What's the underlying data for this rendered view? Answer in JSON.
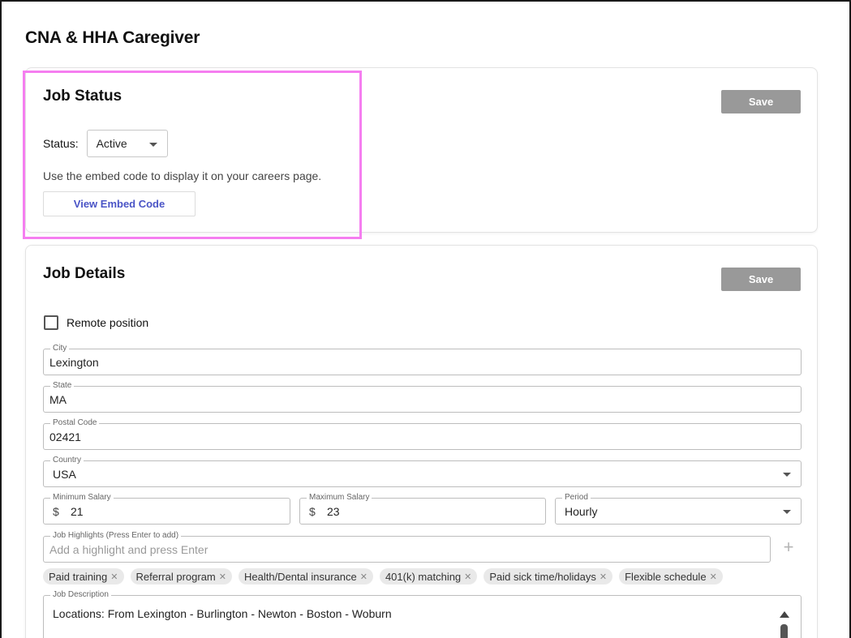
{
  "page": {
    "title": "CNA & HHA Caregiver"
  },
  "job_status": {
    "title": "Job Status",
    "save_label": "Save",
    "status_label": "Status:",
    "status_value": "Active",
    "embed_text": "Use the embed code to display it on your careers page.",
    "embed_button": "View Embed Code"
  },
  "job_details": {
    "title": "Job Details",
    "save_label": "Save",
    "remote_label": "Remote position",
    "city": {
      "label": "City",
      "value": "Lexington"
    },
    "state": {
      "label": "State",
      "value": "MA"
    },
    "postal": {
      "label": "Postal Code",
      "value": "02421"
    },
    "country": {
      "label": "Country",
      "value": "USA"
    },
    "min_salary": {
      "label": "Minimum Salary",
      "currency": "$",
      "value": "21"
    },
    "max_salary": {
      "label": "Maximum Salary",
      "currency": "$",
      "value": "23"
    },
    "period": {
      "label": "Period",
      "value": "Hourly"
    },
    "highlights": {
      "label": "Job Highlights (Press Enter to add)",
      "placeholder": "Add a highlight and press Enter",
      "add_icon": "+",
      "chips": [
        "Paid training",
        "Referral program",
        "Health/Dental insurance",
        "401(k) matching",
        "Paid sick time/holidays",
        "Flexible schedule"
      ],
      "chip_remove": "✕"
    },
    "description": {
      "label": "Job Description",
      "value": "Locations: From Lexington - Burlington - Newton - Boston - Woburn"
    }
  },
  "colors": {
    "save_button": "#999999",
    "embed_link": "#4a54c6",
    "highlight_outline": "#f57ef0"
  }
}
